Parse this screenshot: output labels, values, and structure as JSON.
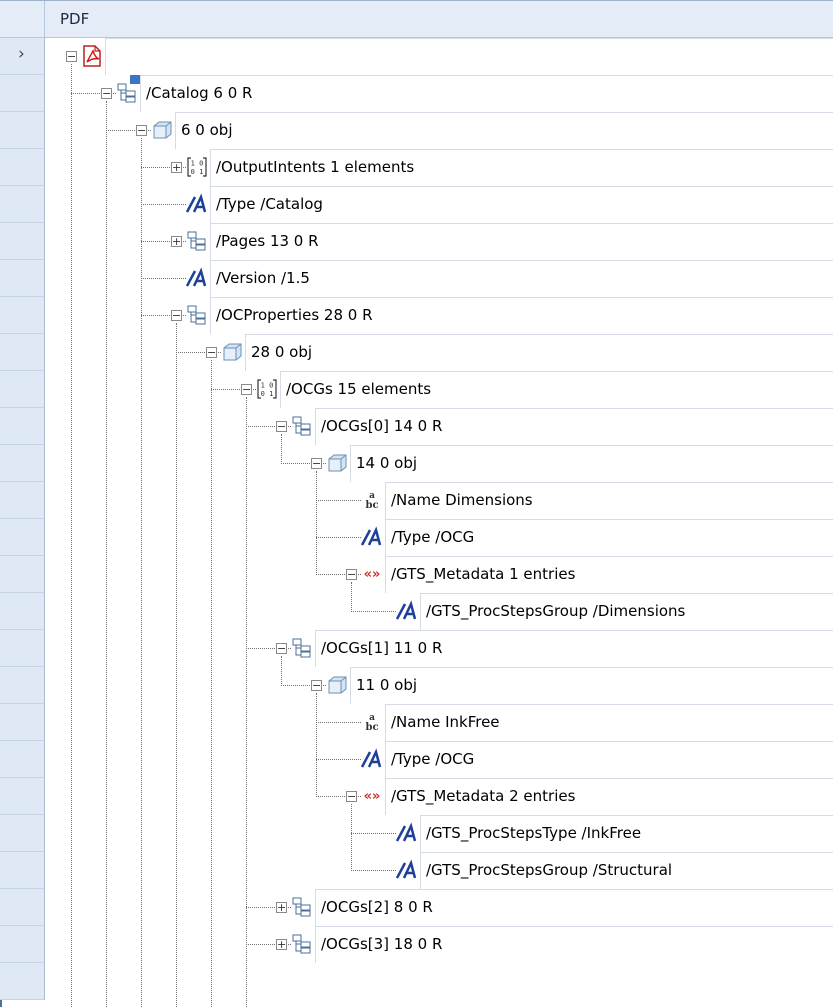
{
  "header": {
    "title": "PDF"
  },
  "tree": [
    {
      "label": "",
      "icon": "pdf-file-icon",
      "expander": "minus",
      "selected": true
    },
    {
      "label": "/Catalog 6 0 R",
      "icon": "dictionary-ref-icon",
      "expander": "minus"
    },
    {
      "label": "6 0 obj",
      "icon": "object-cube-icon",
      "expander": "minus"
    },
    {
      "label": "/OutputIntents 1 elements",
      "icon": "array-icon",
      "expander": "plus"
    },
    {
      "label": "/Type /Catalog",
      "icon": "name-icon",
      "expander": "none"
    },
    {
      "label": "/Pages 13 0 R",
      "icon": "dictionary-ref-icon",
      "expander": "plus"
    },
    {
      "label": "/Version /1.5",
      "icon": "name-icon",
      "expander": "none"
    },
    {
      "label": "/OCProperties 28 0 R",
      "icon": "dictionary-ref-icon",
      "expander": "minus"
    },
    {
      "label": "28 0 obj",
      "icon": "object-cube-icon",
      "expander": "minus"
    },
    {
      "label": "/OCGs 15 elements",
      "icon": "array-icon",
      "expander": "minus"
    },
    {
      "label": "/OCGs[0] 14 0 R",
      "icon": "dictionary-ref-icon",
      "expander": "minus"
    },
    {
      "label": "14 0 obj",
      "icon": "object-cube-icon",
      "expander": "minus"
    },
    {
      "label": "/Name Dimensions",
      "icon": "string-icon",
      "expander": "none"
    },
    {
      "label": "/Type /OCG",
      "icon": "name-icon",
      "expander": "none"
    },
    {
      "label": "/GTS_Metadata 1 entries",
      "icon": "dictionary-icon",
      "expander": "minus"
    },
    {
      "label": "/GTS_ProcStepsGroup /Dimensions",
      "icon": "name-icon",
      "expander": "none"
    },
    {
      "label": "/OCGs[1] 11 0 R",
      "icon": "dictionary-ref-icon",
      "expander": "minus"
    },
    {
      "label": "11 0 obj",
      "icon": "object-cube-icon",
      "expander": "minus"
    },
    {
      "label": "/Name InkFree",
      "icon": "string-icon",
      "expander": "none"
    },
    {
      "label": "/Type /OCG",
      "icon": "name-icon",
      "expander": "none"
    },
    {
      "label": "/GTS_Metadata 2 entries",
      "icon": "dictionary-icon",
      "expander": "minus"
    },
    {
      "label": "/GTS_ProcStepsType /InkFree",
      "icon": "name-icon",
      "expander": "none"
    },
    {
      "label": "/GTS_ProcStepsGroup /Structural",
      "icon": "name-icon",
      "expander": "none"
    },
    {
      "label": "/OCGs[2] 8 0 R",
      "icon": "dictionary-ref-icon",
      "expander": "plus"
    },
    {
      "label": "/OCGs[3] 18 0 R",
      "icon": "dictionary-ref-icon",
      "expander": "plus"
    }
  ],
  "colors": {
    "header_bg": "#e4ecf7",
    "selection": "#3a73c8",
    "grid": "#d5dbe4"
  }
}
